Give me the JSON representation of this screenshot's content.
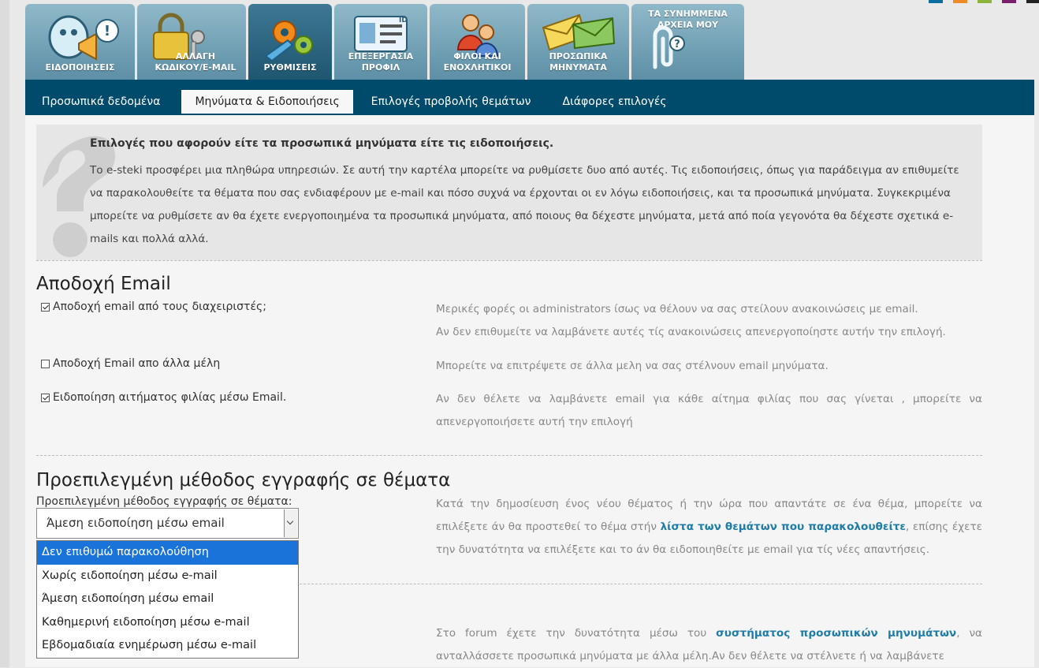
{
  "colors": {
    "nav_bar": "#004a6b",
    "link": "#1f7da8",
    "selected_option": "#1a73d9",
    "swatches": [
      "#0a6da0",
      "#f08a24",
      "#8cb43c",
      "#7a1e6e",
      "#222222"
    ]
  },
  "top_tabs": [
    {
      "icon": "megaphone-icon",
      "label": "ΕΙΔΟΠΟΙΗΣΕΙΣ"
    },
    {
      "icon": "padlock-key-icon",
      "label": "ΑΛΛΑΓΗ ΚΩΔΙΚΟΥ/E-MAIL"
    },
    {
      "icon": "gears-icon",
      "label": "ΡΥΘΜΙΣΕΙΣ",
      "active": true
    },
    {
      "icon": "id-card-icon",
      "label": "ΕΠΕΞΕΡΓΑΣΙΑ ΠΡΟΦΙΛ"
    },
    {
      "icon": "friends-icon",
      "label": "ΦΙΛΟΙ ΚΑΙ ΕΝΟΧΛΗΤΙΚΟΙ"
    },
    {
      "icon": "envelopes-icon",
      "label": "ΠΡΟΣΩΠΙΚΑ ΜΗΝΥΜΑΤΑ"
    },
    {
      "icon": "paperclip-icon",
      "label": "ΤΑ ΣΥΝΗΜΜΕΝΑ ΑΡΧΕΙΑ ΜΟΥ"
    }
  ],
  "sub_tabs": [
    "Προσωπικά δεδομένα",
    "Μηνύματα & Ειδοποιήσεις",
    "Επιλογές προβολής θεμάτων",
    "Διάφορες επιλογές"
  ],
  "info": {
    "icon": "question-mark-icon",
    "title": "Επιλογές που αφορούν είτε τα προσωπικά μηνύματα είτε τις ειδοποιήσεις.",
    "text": "Το e-steki προσφέρει μια πληθώρα υπηρεσιών. Σε αυτή την καρτέλα μπορείτε να ρυθμίσετε δυο από αυτές. Τις ειδοποιήσεις, όπως για παράδειγμα αν επιθυμείτε να παρακολουθείτε τα θέματα που σας ενδιαφέρουν με e-mail και πόσο συχνά να έρχονται οι εν λόγω ειδοποιήσεις, και τα προσωπικά μηνύματα. Συγκεκριμένα μπορείτε να ρυθμίσετε αν θα έχετε ενεργοποιημένα τα προσωπικά μηνύματα, από ποιους θα δέχεστε μηνύματα, μετά από ποία γεγονότα θα δέχεστε σχετικά e-mails και πολλά αλλά."
  },
  "email_section": {
    "title": "Αποδοχή Email",
    "options": [
      {
        "label": "Αποδοχή email από τους διαχειριστές;",
        "checked": true,
        "desc_lines": [
          "Μερικές φορές οι administrators ίσως να θέλουν να σας στείλουν ανακοινώσεις με email.",
          "Αν δεν επιθυμείτε να λαμβάνετε αυτές τίς ανακοινώσεις απενεργοποίηστε αυτήν την επιλογή."
        ]
      },
      {
        "label": "Αποδοχή Email απο άλλα μέλη",
        "checked": false,
        "desc_lines": [
          "Μπορείτε να επιτρέψετε σε άλλα μελη να σας στέλνουν email μηνύματα."
        ]
      },
      {
        "label": "Ειδοποίηση αιτήματος φιλίας μέσω Email.",
        "checked": true,
        "desc_lines": [
          "Αν δεν θέλετε να λαμβάνετε email για κάθε αίτημα φιλίας που σας γίνεται , μπορείτε να απενεργοποιήσετε αυτή την επιλογή"
        ]
      }
    ]
  },
  "subscribe_section": {
    "title": "Προεπιλεγμένη μέθοδος εγγραφής σε θέματα",
    "select_label": "Προεπιλεγμένη μέθοδος εγγραφής σε θέματα:",
    "selected_value": "Άμεση ειδοποίηση μέσω email",
    "options": [
      "Δεν επιθυμώ παρακολούθηση",
      "Χωρίς ειδοποίηση μέσω e-mail",
      "Άμεση ειδοποίηση μέσω email",
      "Καθημερινή ειδοποίηση μέσω e-mail",
      "Εβδομαδιαία ενημέρωση μέσω e-mail"
    ],
    "highlighted_option": "Δεν επιθυμώ παρακολούθηση",
    "desc_before": "Κατά την δημοσίευση ένος νέου θέματος ή την ώρα που απαντάτε σε ένα θέμα, μπορείτε να επιλέξετε άν θα προστεθεί το θέμα στήν ",
    "desc_link": "λίστα των θεμάτων που παρακολουθείτε",
    "desc_after": ", επίσης έχετε την δυνατότητα να επιλέξετε και το άν θα ειδοποιηθείτε με email για τίς νέες απαντήσεις."
  },
  "pm_section": {
    "desc_before": "Στο forum έχετε την δυνατότητα μέσω του ",
    "desc_link": "συστήματος προσωπικών μηνυμάτων",
    "desc_after": ", να ανταλλάσσετε προσωπικά μηνύματα με άλλα μέλη.Αν δεν θέλετε να στέλνετε ή να λαμβάνετε"
  }
}
